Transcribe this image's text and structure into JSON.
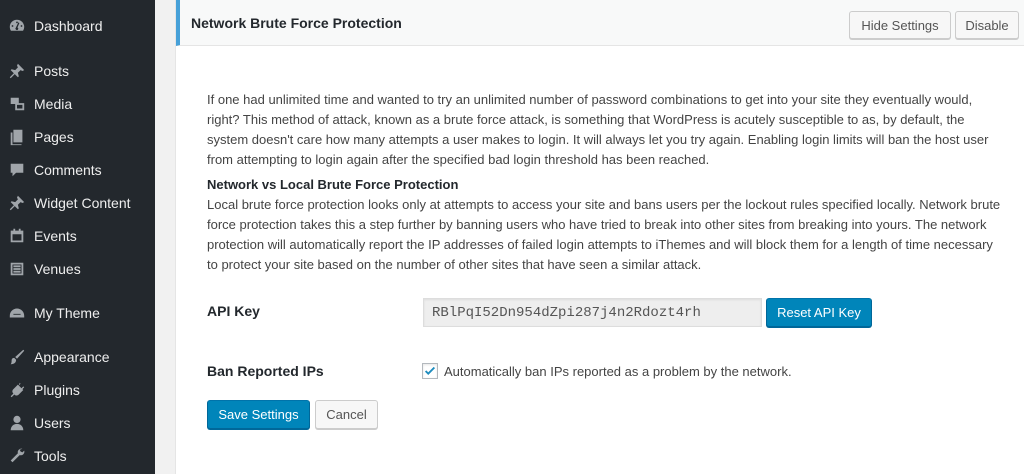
{
  "sidebar": {
    "items": [
      {
        "label": "Dashboard",
        "icon": "dashboard-icon"
      },
      {
        "label": "Posts",
        "icon": "pin-icon"
      },
      {
        "label": "Media",
        "icon": "media-icon"
      },
      {
        "label": "Pages",
        "icon": "pages-icon"
      },
      {
        "label": "Comments",
        "icon": "comment-icon"
      },
      {
        "label": "Widget Content",
        "icon": "pin-icon"
      },
      {
        "label": "Events",
        "icon": "calendar-icon"
      },
      {
        "label": "Venues",
        "icon": "venue-icon"
      },
      {
        "label": "My Theme",
        "icon": "helmet-icon"
      },
      {
        "label": "Appearance",
        "icon": "brush-icon"
      },
      {
        "label": "Plugins",
        "icon": "plug-icon"
      },
      {
        "label": "Users",
        "icon": "user-icon"
      },
      {
        "label": "Tools",
        "icon": "wrench-icon"
      }
    ]
  },
  "panel": {
    "title": "Network Brute Force Protection",
    "hide_settings_label": "Hide Settings",
    "disable_label": "Disable"
  },
  "description": {
    "intro": "If one had unlimited time and wanted to try an unlimited number of password combinations to get into your site they eventually would, right? This method of attack, known as a brute force attack, is something that WordPress is acutely susceptible to as, by default, the system doesn't care how many attempts a user makes to login. It will always let you try again. Enabling login limits will ban the host user from attempting to login again after the specified bad login threshold has been reached.",
    "subheading": "Network vs Local Brute Force Protection",
    "detail": "Local brute force protection looks only at attempts to access your site and bans users per the lockout rules specified locally. Network brute force protection takes this a step further by banning users who have tried to break into other sites from breaking into yours. The network protection will automatically report the IP addresses of failed login attempts to iThemes and will block them for a length of time necessary to protect your site based on the number of other sites that have seen a similar attack."
  },
  "api_key": {
    "label": "API Key",
    "value": "RBlPqI52Dn954dZpi287j4n2Rdozt4rh",
    "reset_label": "Reset API Key"
  },
  "ban_ips": {
    "label": "Ban Reported IPs",
    "checked": true,
    "checkbox_label": "Automatically ban IPs reported as a problem by the network."
  },
  "actions": {
    "save_label": "Save Settings",
    "cancel_label": "Cancel"
  },
  "colors": {
    "sidebar_bg": "#23282d",
    "primary": "#0085ba",
    "header_accent": "#46a0d8"
  }
}
